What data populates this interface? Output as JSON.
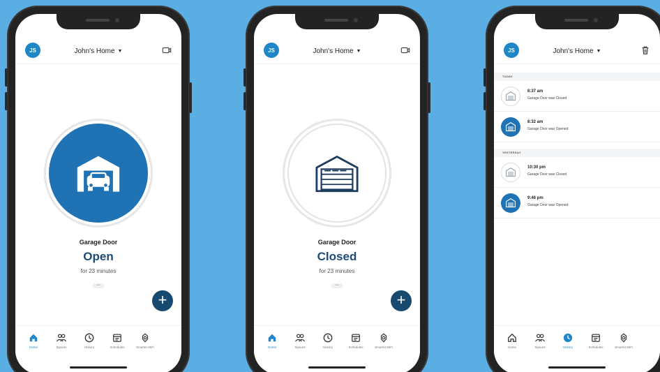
{
  "app": {
    "avatar_initials": "JS",
    "home_name": "John's Home",
    "accent": "#1f72b3",
    "dark_accent": "#174a6e"
  },
  "phone1": {
    "door_name": "Garage Door",
    "door_state": "Open",
    "door_duration": "for 23 minutes",
    "more": "•••",
    "fab": "+",
    "header_icon": "camera-icon"
  },
  "phone2": {
    "door_name": "Garage Door",
    "door_state": "Closed",
    "door_duration": "for 23 minutes",
    "more": "•••",
    "fab": "+",
    "header_icon": "camera-icon"
  },
  "phone3": {
    "header_icon": "trash-icon",
    "sections": [
      {
        "label": "TODAY",
        "events": [
          {
            "time": "8:37 am",
            "text": "Garage Door was Closed",
            "icon": "garage-closed-icon"
          },
          {
            "time": "8:32 am",
            "text": "Garage Door was Opened",
            "icon": "garage-open-icon"
          }
        ]
      },
      {
        "label": "YESTERDAY",
        "events": [
          {
            "time": "10:30 pm",
            "text": "Garage Door was Closed",
            "icon": "garage-closed-icon"
          },
          {
            "time": "9:46 pm",
            "text": "Garage Door was Opened",
            "icon": "garage-open-icon"
          }
        ]
      }
    ]
  },
  "tabs": [
    {
      "label": "Home",
      "icon": "home-icon"
    },
    {
      "label": "Spaces",
      "icon": "people-icon"
    },
    {
      "label": "History",
      "icon": "clock-icon"
    },
    {
      "label": "Schedules",
      "icon": "calendar-icon"
    },
    {
      "label": "Smarter MiFi",
      "icon": "device-icon"
    }
  ],
  "active_tab": {
    "phone1": "Home",
    "phone2": "Home",
    "phone3": "History"
  }
}
